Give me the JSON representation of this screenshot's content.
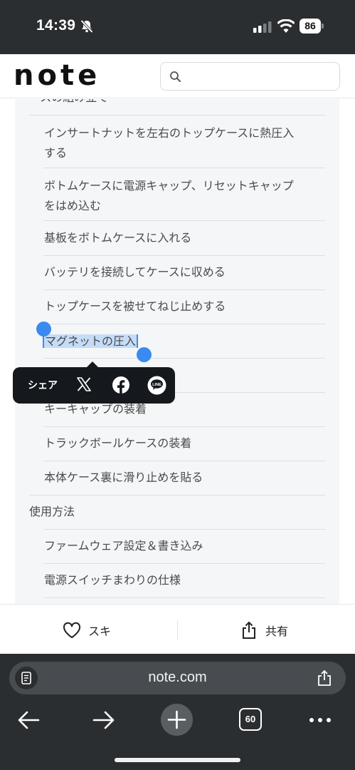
{
  "status_bar": {
    "time": "14:39",
    "battery": "86",
    "icons": [
      "bell-slash-icon",
      "signal-icon",
      "wifi-icon",
      "battery-icon"
    ]
  },
  "header": {
    "logo": "note",
    "search_placeholder": ""
  },
  "toc": {
    "partial_heading": "ースの組み立て",
    "items": [
      "インサートナットを左右のトップケースに熱圧入",
      "する",
      "ボトムケースに電源キャップ、リセットキャップ",
      "をはめ込む",
      "基板をボトムケースに入れる",
      "バッテリを接続してケースに収める",
      "トップケースを被せてねじ止めする",
      "マグネットの圧入",
      "キーキャップの装着",
      "トラックボールケースの装着",
      "本体ケース裏に滑り止めを貼る",
      "使用方法",
      "ファームウェア設定＆書き込み",
      "電源スイッチまわりの仕様"
    ],
    "selected_item": "マグネットの圧入"
  },
  "share_popup": {
    "label": "シェア",
    "targets": [
      "x-icon",
      "facebook-icon",
      "line-icon"
    ],
    "line_text": "LINE"
  },
  "actions": {
    "like_label": "スキ",
    "share_label": "共有"
  },
  "browser": {
    "url": "note.com",
    "tab_count": "60",
    "accent": "#3b8af0"
  }
}
